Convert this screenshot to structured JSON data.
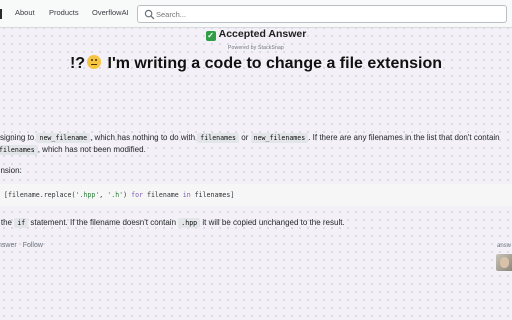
{
  "nav": {
    "about": "About",
    "products": "Products",
    "overflowai": "OverflowAI"
  },
  "search": {
    "placeholder": "Search..."
  },
  "header": {
    "accepted": "Accepted Answer",
    "powered": "Powered by StackSnap"
  },
  "title": {
    "prefix": "!?",
    "text": "I'm writing a code to change a file extension"
  },
  "answer": {
    "p1_a": "ssigning to ",
    "p1_code1": "new_filename",
    "p1_b": ", which has nothing to do with ",
    "p1_code2": "filenames",
    "p1_c": " or ",
    "p1_code3": "new_filenames",
    "p1_d": ". If there are any filenames in the list that don't contain",
    "p2_code": "filenames",
    "p2_text": ", which has not been modified.",
    "p3": "ension:",
    "code_open": "[filename.replace(",
    "code_arg1": "'.hpp'",
    "code_comma": ", ",
    "code_arg2": "'.h'",
    "code_close": ") ",
    "code_for": "for",
    "code_var": " filename ",
    "code_in": "in",
    "code_end": " filenames]",
    "p4_a": "r the ",
    "p4_code1": "if",
    "p4_b": " statement. If the filename doesn't contain ",
    "p4_code2": ".hpp",
    "p4_c": " it will be copied unchanged to the result."
  },
  "post": {
    "share": "nswer",
    "follow": "Follow",
    "answered": "answ"
  },
  "icons": {
    "search": "search-icon",
    "check": "check-icon",
    "emoji": "confused-face-icon",
    "avatar": "user-avatar"
  },
  "colors": {
    "accepted_green": "#2f9e44",
    "background": "#f3f1f7"
  }
}
